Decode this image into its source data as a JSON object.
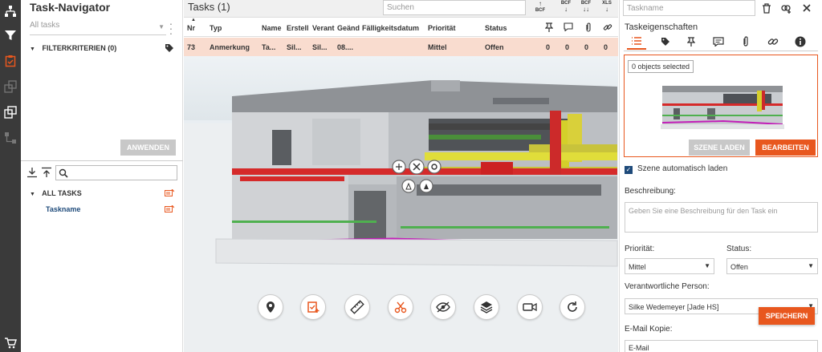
{
  "rail": {
    "icons": [
      "hierarchy-icon",
      "filter-icon",
      "tasks-clipboard-icon",
      "copy-layers-icon",
      "compare-icon",
      "structure-icon",
      "cart-icon"
    ]
  },
  "navigator": {
    "title": "Task-Navigator",
    "filter_select": "All tasks",
    "filter_criteria": "FILTERKRITERIEN (0)",
    "apply_label": "ANWENDEN",
    "all_tasks_label": "ALL TASKS",
    "task_item": "Taskname"
  },
  "tasks_panel": {
    "title": "Tasks (1)",
    "search_placeholder": "Suchen",
    "exports": [
      {
        "label": "BCF",
        "arrow": "↑"
      },
      {
        "label": "BCF",
        "arrow": "↓"
      },
      {
        "label": "BCF",
        "arrow": "↓↓"
      },
      {
        "label": "XLS",
        "arrow": "↓"
      }
    ],
    "columns": [
      "Nr",
      "Typ",
      "Name",
      "Erstell",
      "Verant",
      "Geänd",
      "Fälligkeitsdatum",
      "Priorität",
      "Status"
    ],
    "row": {
      "nr": "73",
      "typ": "Anmerkung",
      "name": "Ta...",
      "erstell": "Sil...",
      "verant": "Sil...",
      "geaend": "08....",
      "faellig": "",
      "prioritaet": "Mittel",
      "status": "Offen",
      "c1": "0",
      "c2": "0",
      "c3": "0",
      "c4": "0"
    },
    "viewer_tools": [
      "location-pin-icon",
      "add-task-icon",
      "measure-icon",
      "section-cut-icon",
      "hide-eye-icon",
      "layers-icon",
      "camera-icon",
      "reset-rotate-icon"
    ]
  },
  "properties": {
    "taskname_placeholder": "Taskname",
    "title": "Taskeigenschaften",
    "objects_selected": "0 objects selected",
    "load_scene": "SZENE LADEN",
    "edit": "BEARBEITEN",
    "auto_load": "Szene automatisch laden",
    "description_label": "Beschreibung:",
    "description_placeholder": "Geben Sie eine Beschreibung für den Task ein",
    "priority_label": "Priorität:",
    "priority_value": "Mittel",
    "status_label": "Status:",
    "status_value": "Offen",
    "responsible_label": "Verantwortliche Person:",
    "responsible_value": "Silke Wedemeyer [Jade HS]",
    "save_label": "SPEICHERN",
    "email_label": "E-Mail Kopie:",
    "email_value": "E-Mail"
  },
  "colors": {
    "accent": "#e8571e",
    "navy": "#1e4a7a",
    "rail": "#3a3a3a",
    "row_highlight": "#f9dccf"
  }
}
